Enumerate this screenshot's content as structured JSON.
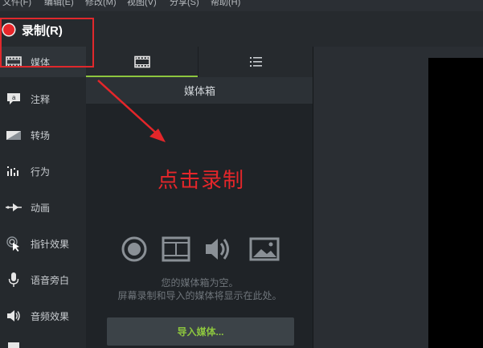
{
  "menubar": {
    "items": [
      "文件(F)",
      "编辑(E)",
      "修改(M)",
      "视图(V)",
      "分享(S)",
      "帮助(H)"
    ]
  },
  "record": {
    "label": "录制(R)"
  },
  "sidebar": {
    "items": [
      {
        "label": "媒体",
        "icon": "film-icon",
        "active": true
      },
      {
        "label": "注释",
        "icon": "annotation-icon"
      },
      {
        "label": "转场",
        "icon": "transition-icon"
      },
      {
        "label": "行为",
        "icon": "behavior-icon"
      },
      {
        "label": "动画",
        "icon": "animation-icon"
      },
      {
        "label": "指针效果",
        "icon": "cursor-effect-icon"
      },
      {
        "label": "语音旁白",
        "icon": "microphone-icon"
      },
      {
        "label": "音频效果",
        "icon": "speaker-icon"
      }
    ]
  },
  "tabs": [
    {
      "icon": "film-strip-icon",
      "active": true
    },
    {
      "icon": "list-icon"
    }
  ],
  "media_bin": {
    "title": "媒体箱",
    "empty_line1": "您的媒体箱为空。",
    "empty_line2": "屏幕录制和导入的媒体将显示在此处。",
    "import_label": "导入媒体..."
  },
  "annotation": {
    "text": "点击录制"
  },
  "colors": {
    "accent_green": "#8dc63f",
    "record_red": "#e8262a",
    "annotation_red": "#e4262a"
  }
}
